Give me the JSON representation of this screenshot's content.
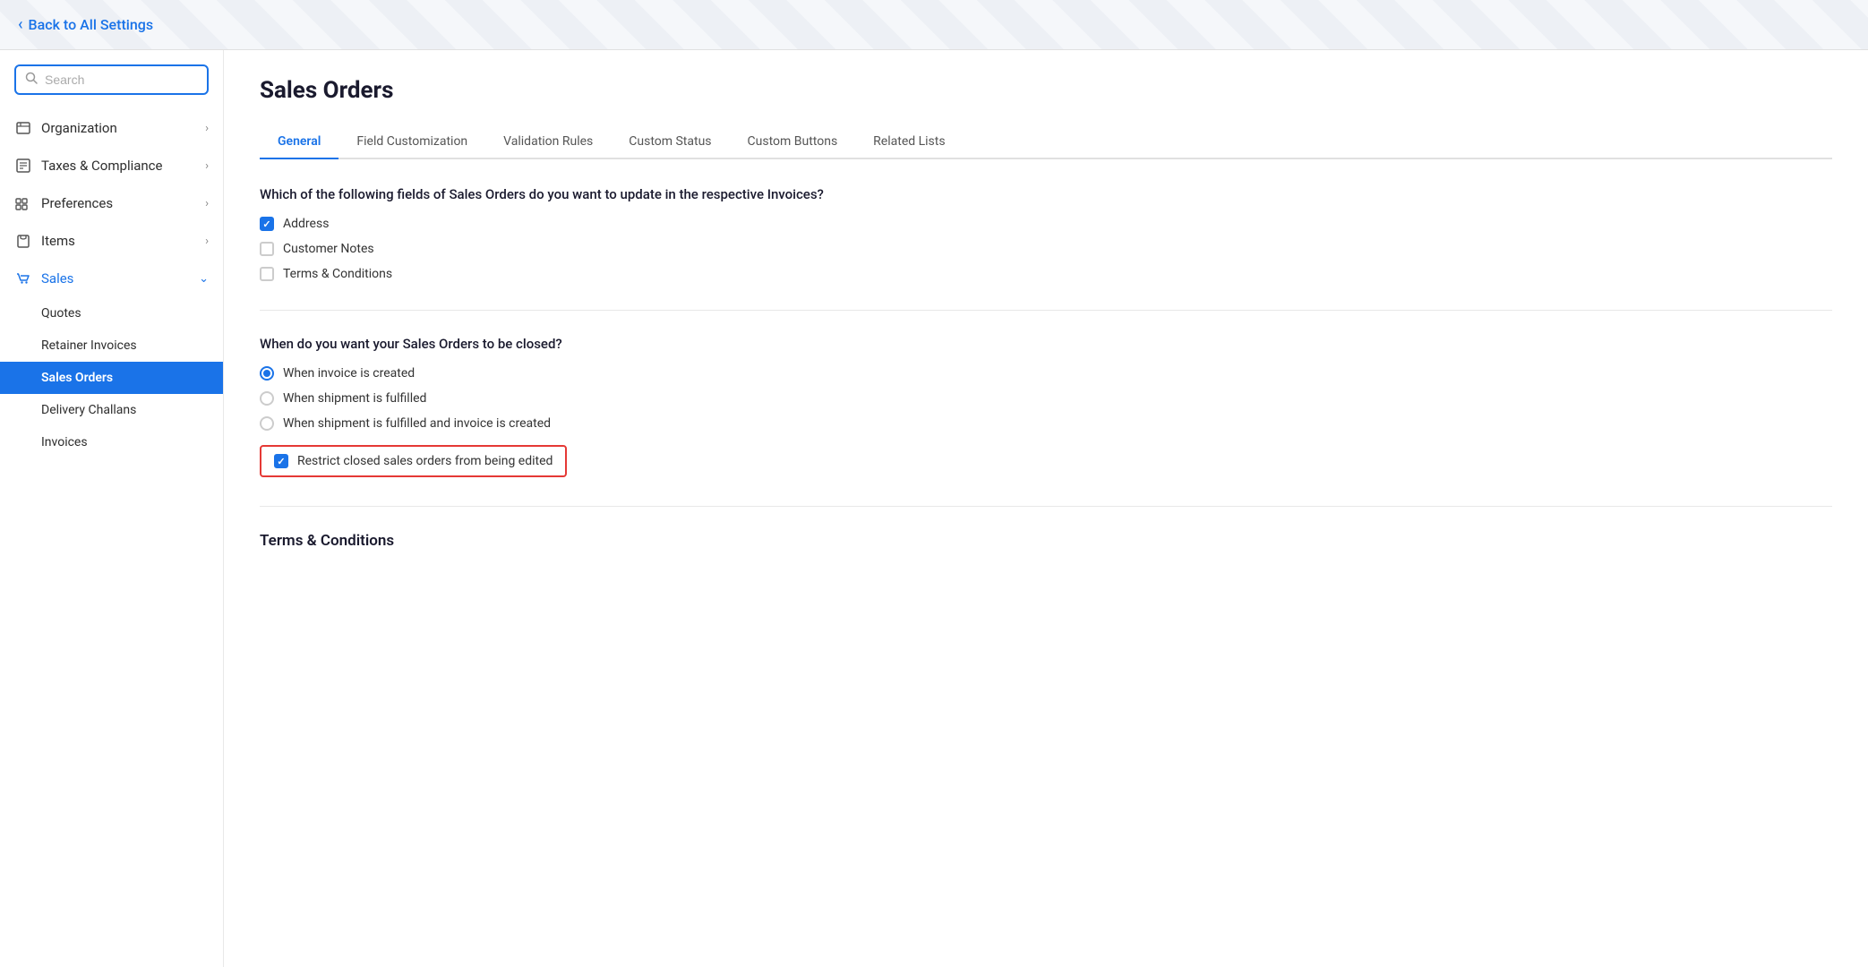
{
  "topBar": {
    "backLabel": "Back to All Settings"
  },
  "sidebar": {
    "searchPlaceholder": "Search",
    "navItems": [
      {
        "id": "organization",
        "label": "Organization",
        "icon": "org",
        "hasChevron": true,
        "active": false
      },
      {
        "id": "taxes",
        "label": "Taxes & Compliance",
        "icon": "tax",
        "hasChevron": true,
        "active": false
      },
      {
        "id": "preferences",
        "label": "Preferences",
        "icon": "pref",
        "hasChevron": true,
        "active": false
      },
      {
        "id": "items",
        "label": "Items",
        "icon": "items",
        "hasChevron": true,
        "active": false
      },
      {
        "id": "sales",
        "label": "Sales",
        "icon": "sales",
        "hasChevron": true,
        "activeParent": true
      }
    ],
    "subItems": [
      {
        "id": "quotes",
        "label": "Quotes",
        "active": false
      },
      {
        "id": "retainer",
        "label": "Retainer Invoices",
        "active": false
      },
      {
        "id": "sales-orders",
        "label": "Sales Orders",
        "active": true
      },
      {
        "id": "delivery",
        "label": "Delivery Challans",
        "active": false
      },
      {
        "id": "invoices",
        "label": "Invoices",
        "active": false
      }
    ]
  },
  "main": {
    "pageTitle": "Sales Orders",
    "tabs": [
      {
        "id": "general",
        "label": "General",
        "active": true
      },
      {
        "id": "field-customization",
        "label": "Field Customization",
        "active": false
      },
      {
        "id": "validation-rules",
        "label": "Validation Rules",
        "active": false
      },
      {
        "id": "custom-status",
        "label": "Custom Status",
        "active": false
      },
      {
        "id": "custom-buttons",
        "label": "Custom Buttons",
        "active": false
      },
      {
        "id": "related-lists",
        "label": "Related Lists",
        "active": false
      }
    ],
    "sections": {
      "invoiceFields": {
        "question": "Which of the following fields of Sales Orders do you want to update in the respective Invoices?",
        "checkboxes": [
          {
            "id": "address",
            "label": "Address",
            "checked": true
          },
          {
            "id": "customer-notes",
            "label": "Customer Notes",
            "checked": false
          },
          {
            "id": "terms-conditions",
            "label": "Terms & Conditions",
            "checked": false
          }
        ]
      },
      "closedOrders": {
        "question": "When do you want your Sales Orders to be closed?",
        "radios": [
          {
            "id": "invoice-created",
            "label": "When invoice is created",
            "selected": true
          },
          {
            "id": "shipment-fulfilled",
            "label": "When shipment is fulfilled",
            "selected": false
          },
          {
            "id": "both",
            "label": "When shipment is fulfilled and invoice is created",
            "selected": false
          }
        ],
        "restrictCheckbox": {
          "label": "Restrict closed sales orders from being edited",
          "checked": true
        }
      },
      "termsConditions": {
        "title": "Terms & Conditions"
      }
    }
  }
}
